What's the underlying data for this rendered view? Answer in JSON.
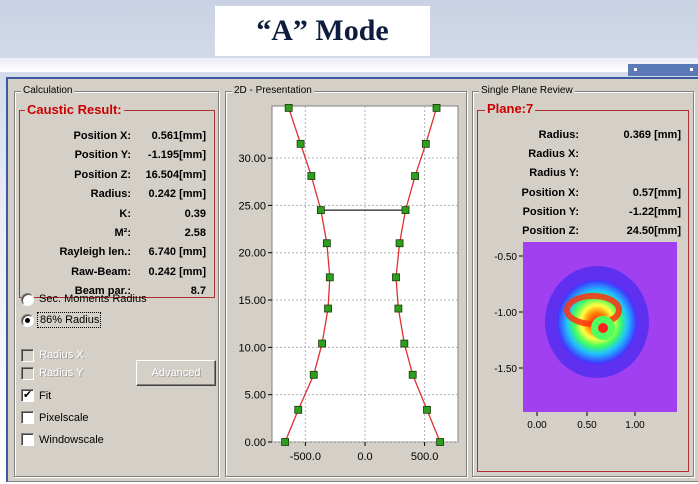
{
  "slide": {
    "title": "“A” Mode"
  },
  "calculation": {
    "group_label": "Calculation",
    "section_title": "Caustic Result:",
    "rows": [
      {
        "label": "Position X:",
        "value": "0.561[mm]"
      },
      {
        "label": "Position Y:",
        "value": "-1.195[mm]"
      },
      {
        "label": "Position Z:",
        "value": "16.504[mm]"
      },
      {
        "label": "Radius:",
        "value": "0.242 [mm]"
      },
      {
        "label": "K:",
        "value": "0.39"
      },
      {
        "label": "M²:",
        "value": "2.58"
      },
      {
        "label": "Rayleigh len.:",
        "value": "6.740 [mm]"
      },
      {
        "label": "Raw-Beam:",
        "value": "0.242 [mm]"
      },
      {
        "label": "Beam par.:",
        "value": "8.7"
      }
    ],
    "radio_options": [
      {
        "label": "Sec. Moments Radius",
        "selected": false
      },
      {
        "label": "86% Radius",
        "selected": true
      }
    ],
    "disabled_checks": [
      {
        "label": "Radius X",
        "checked": false
      },
      {
        "label": "Radius Y",
        "checked": false
      }
    ],
    "advanced_button": "Advanced",
    "checks": [
      {
        "label": "Fit",
        "checked": true
      },
      {
        "label": "Pixelscale",
        "checked": false
      },
      {
        "label": "Windowscale",
        "checked": false
      }
    ]
  },
  "presentation": {
    "group_label": "2D - Presentation",
    "chart_data": {
      "type": "scatter",
      "title": "",
      "xlabel": "",
      "ylabel": "",
      "xlim": [
        -780,
        780
      ],
      "ylim": [
        0,
        35.5
      ],
      "x_ticks": [
        -500,
        0,
        500
      ],
      "x_tick_labels": [
        "-500.0",
        "0.0",
        "500.0"
      ],
      "y_ticks": [
        0,
        5,
        10,
        15,
        20,
        25,
        30
      ],
      "y_tick_labels": [
        "0.00",
        "5.00",
        "10.00",
        "15.00",
        "20.00",
        "25.00",
        "30.00"
      ],
      "grid": true,
      "series": [
        {
          "side": "left",
          "points": [
            [
              -670,
              0
            ],
            [
              -560,
              3.4
            ],
            [
              -430,
              7.1
            ],
            [
              -360,
              10.4
            ],
            [
              -310,
              14.1
            ],
            [
              -295,
              17.4
            ],
            [
              -320,
              21.0
            ],
            [
              -370,
              24.5
            ],
            [
              -450,
              28.1
            ],
            [
              -540,
              31.5
            ],
            [
              -640,
              35.3
            ]
          ]
        },
        {
          "side": "right",
          "points": [
            [
              630,
              0
            ],
            [
              520,
              3.4
            ],
            [
              400,
              7.1
            ],
            [
              330,
              10.4
            ],
            [
              280,
              14.1
            ],
            [
              260,
              17.4
            ],
            [
              290,
              21.0
            ],
            [
              340,
              24.5
            ],
            [
              420,
              28.1
            ],
            [
              510,
              31.5
            ],
            [
              600,
              35.3
            ]
          ]
        }
      ],
      "waist_marker": {
        "x1": -370,
        "x2": 340,
        "y": 24.5
      },
      "colors": {
        "fit_curve": "#e03030",
        "point_fill": "#2e9e1e",
        "point_edge": "#1a3a0a"
      }
    }
  },
  "single_plane": {
    "group_label": "Single Plane Review",
    "section_title": "Plane:7",
    "rows": [
      {
        "label": "Radius:",
        "value": "0.369 [mm]"
      },
      {
        "label": "Radius X:",
        "value": ""
      },
      {
        "label": "Radius Y:",
        "value": ""
      },
      {
        "label": "Position X:",
        "value": "0.57[mm]"
      },
      {
        "label": "Position Y:",
        "value": "-1.22[mm]"
      },
      {
        "label": "Position Z:",
        "value": "24.50[mm]"
      }
    ],
    "image_axes": {
      "x_tick_labels": [
        "0.00",
        "0.50",
        "1.00"
      ],
      "y_tick_labels": [
        "-0.50",
        "-1.00",
        "-1.50"
      ]
    }
  }
}
